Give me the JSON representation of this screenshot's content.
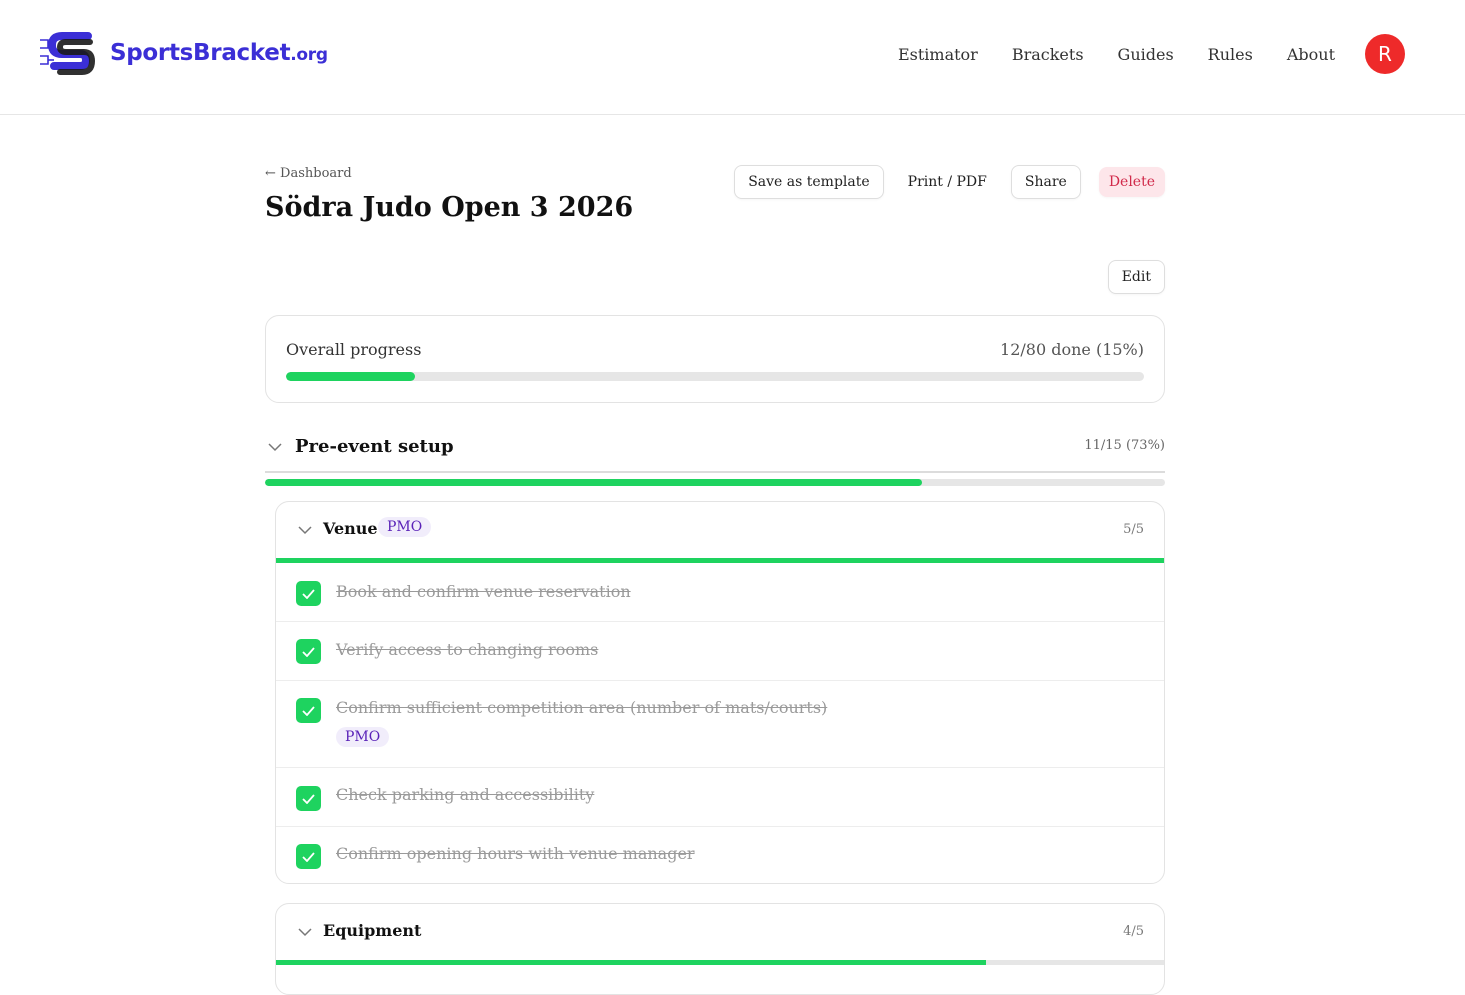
{
  "brand": {
    "name": "SportsBracket",
    "tld": ".org"
  },
  "nav": {
    "items": [
      {
        "label": "Estimator"
      },
      {
        "label": "Brackets"
      },
      {
        "label": "Guides"
      },
      {
        "label": "Rules"
      },
      {
        "label": "About"
      }
    ],
    "avatar_initial": "R"
  },
  "page": {
    "back_link": "← Dashboard",
    "title": "Södra Judo Open 3 2026",
    "actions": {
      "save_template": "Save as template",
      "print_pdf": "Print / PDF",
      "share": "Share",
      "delete": "Delete"
    },
    "edit": "Edit"
  },
  "overall": {
    "label": "Overall progress",
    "value_text": "12/80 done (15%)",
    "fraction": 0.15
  },
  "section": {
    "title": "Pre-event setup",
    "count": "11/15 (73%)",
    "fraction": 0.73,
    "groups": [
      {
        "title": "Venue",
        "badge": "PMO",
        "count": "5/5",
        "fraction": 1.0,
        "tasks": [
          {
            "text": "Book and confirm venue reservation",
            "done": true
          },
          {
            "text": "Verify access to changing rooms",
            "done": true
          },
          {
            "text": "Confirm sufficient competition area (number of mats/courts)",
            "done": true,
            "badge": "PMO"
          },
          {
            "text": "Check parking and accessibility",
            "done": true
          },
          {
            "text": "Confirm opening hours with venue manager",
            "done": true
          }
        ]
      },
      {
        "title": "Equipment",
        "count": "4/5",
        "fraction": 0.8
      }
    ]
  },
  "colors": {
    "brand": "#3b2fd6",
    "progress": "#1ed35f",
    "danger": "#d12a4a",
    "badge_text": "#5a22b8",
    "avatar": "#ee2a2a"
  }
}
